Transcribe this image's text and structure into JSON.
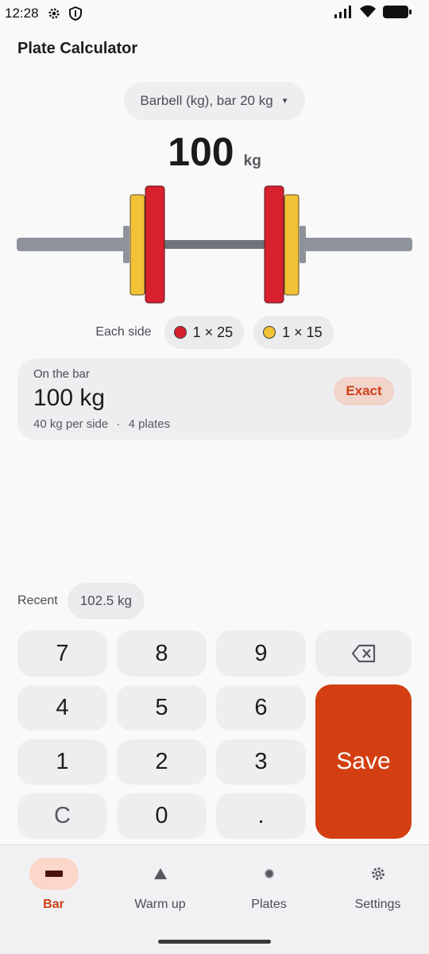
{
  "status": {
    "time": "12:28"
  },
  "app": {
    "title": "Plate Calculator"
  },
  "equipment": {
    "selected": "Barbell (kg), bar 20 kg"
  },
  "target": {
    "value": "100",
    "unit": "kg"
  },
  "each_side": {
    "label": "Each side",
    "plates": [
      {
        "count_label": "1 × 25",
        "color": "#d8202f"
      },
      {
        "count_label": "1 × 15",
        "color": "#f2c236"
      }
    ]
  },
  "summary": {
    "caption": "On the bar",
    "value": "100 kg",
    "per_side": "40 kg per side",
    "separator": "·",
    "plates": "4 plates",
    "badge": "Exact"
  },
  "recent": {
    "label": "Recent",
    "items": [
      "102.5 kg"
    ]
  },
  "keypad": {
    "keys": [
      "7",
      "8",
      "9",
      "4",
      "5",
      "6",
      "1",
      "2",
      "3",
      "C",
      "0",
      "."
    ],
    "save": "Save"
  },
  "nav": {
    "items": [
      {
        "label": "Bar",
        "icon": "barbell-icon",
        "active": true
      },
      {
        "label": "Warm up",
        "icon": "triangle-icon",
        "active": false
      },
      {
        "label": "Plates",
        "icon": "plate-dot-icon",
        "active": false
      },
      {
        "label": "Settings",
        "icon": "gear-icon",
        "active": false
      }
    ]
  },
  "colors": {
    "accent": "#d33f12",
    "plate_red": "#d8202f",
    "plate_yellow": "#f2c236",
    "bar": "#8e939b"
  }
}
